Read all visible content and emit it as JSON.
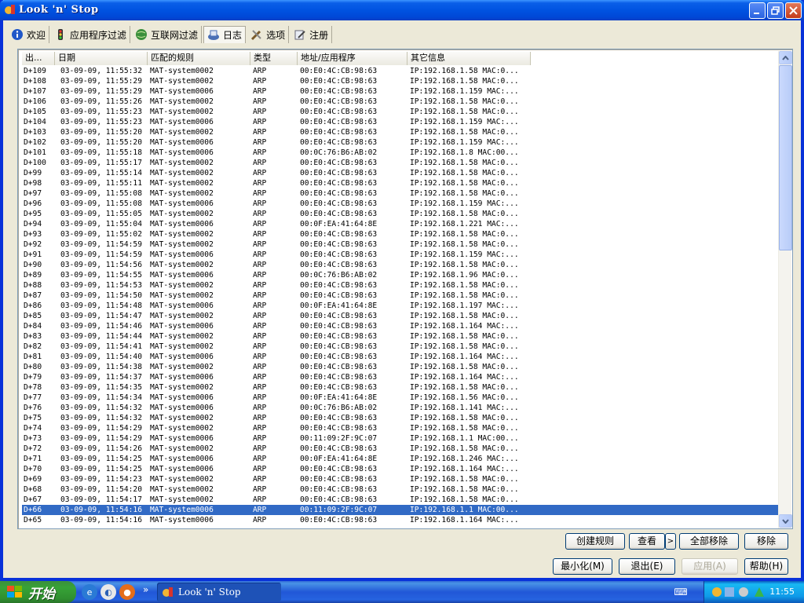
{
  "window": {
    "title": "Look 'n' Stop"
  },
  "tabs": [
    {
      "label": "欢迎",
      "icon": "info-icon"
    },
    {
      "label": "应用程序过滤",
      "icon": "traffic-light-icon"
    },
    {
      "label": "互联网过滤",
      "icon": "globe-icon"
    },
    {
      "label": "日志",
      "icon": "log-icon",
      "active": true
    },
    {
      "label": "选项",
      "icon": "tools-icon"
    },
    {
      "label": "注册",
      "icon": "register-icon"
    }
  ],
  "list": {
    "columns": [
      "出...",
      "日期",
      "匹配的规则",
      "类型",
      "地址/应用程序",
      "其它信息"
    ],
    "rows": [
      [
        "D+109",
        "03-09-09, 11:55:32",
        "MAT-system0002",
        "ARP",
        "00:E0:4C:CB:98:63",
        "IP:192.168.1.58 MAC:0..."
      ],
      [
        "D+108",
        "03-09-09, 11:55:29",
        "MAT-system0002",
        "ARP",
        "00:E0:4C:CB:98:63",
        "IP:192.168.1.58 MAC:0..."
      ],
      [
        "D+107",
        "03-09-09, 11:55:29",
        "MAT-system0006",
        "ARP",
        "00:E0:4C:CB:98:63",
        "IP:192.168.1.159 MAC:..."
      ],
      [
        "D+106",
        "03-09-09, 11:55:26",
        "MAT-system0002",
        "ARP",
        "00:E0:4C:CB:98:63",
        "IP:192.168.1.58 MAC:0..."
      ],
      [
        "D+105",
        "03-09-09, 11:55:23",
        "MAT-system0002",
        "ARP",
        "00:E0:4C:CB:98:63",
        "IP:192.168.1.58 MAC:0..."
      ],
      [
        "D+104",
        "03-09-09, 11:55:23",
        "MAT-system0006",
        "ARP",
        "00:E0:4C:CB:98:63",
        "IP:192.168.1.159 MAC:..."
      ],
      [
        "D+103",
        "03-09-09, 11:55:20",
        "MAT-system0002",
        "ARP",
        "00:E0:4C:CB:98:63",
        "IP:192.168.1.58 MAC:0..."
      ],
      [
        "D+102",
        "03-09-09, 11:55:20",
        "MAT-system0006",
        "ARP",
        "00:E0:4C:CB:98:63",
        "IP:192.168.1.159 MAC:..."
      ],
      [
        "D+101",
        "03-09-09, 11:55:18",
        "MAT-system0006",
        "ARP",
        "00:0C:76:B6:AB:02",
        "IP:192.168.1.8 MAC:00..."
      ],
      [
        "D+100",
        "03-09-09, 11:55:17",
        "MAT-system0002",
        "ARP",
        "00:E0:4C:CB:98:63",
        "IP:192.168.1.58 MAC:0..."
      ],
      [
        "D+99",
        "03-09-09, 11:55:14",
        "MAT-system0002",
        "ARP",
        "00:E0:4C:CB:98:63",
        "IP:192.168.1.58 MAC:0..."
      ],
      [
        "D+98",
        "03-09-09, 11:55:11",
        "MAT-system0002",
        "ARP",
        "00:E0:4C:CB:98:63",
        "IP:192.168.1.58 MAC:0..."
      ],
      [
        "D+97",
        "03-09-09, 11:55:08",
        "MAT-system0002",
        "ARP",
        "00:E0:4C:CB:98:63",
        "IP:192.168.1.58 MAC:0..."
      ],
      [
        "D+96",
        "03-09-09, 11:55:08",
        "MAT-system0006",
        "ARP",
        "00:E0:4C:CB:98:63",
        "IP:192.168.1.159 MAC:..."
      ],
      [
        "D+95",
        "03-09-09, 11:55:05",
        "MAT-system0002",
        "ARP",
        "00:E0:4C:CB:98:63",
        "IP:192.168.1.58 MAC:0..."
      ],
      [
        "D+94",
        "03-09-09, 11:55:04",
        "MAT-system0006",
        "ARP",
        "00:0F:EA:41:64:8E",
        "IP:192.168.1.221 MAC:..."
      ],
      [
        "D+93",
        "03-09-09, 11:55:02",
        "MAT-system0002",
        "ARP",
        "00:E0:4C:CB:98:63",
        "IP:192.168.1.58 MAC:0..."
      ],
      [
        "D+92",
        "03-09-09, 11:54:59",
        "MAT-system0002",
        "ARP",
        "00:E0:4C:CB:98:63",
        "IP:192.168.1.58 MAC:0..."
      ],
      [
        "D+91",
        "03-09-09, 11:54:59",
        "MAT-system0006",
        "ARP",
        "00:E0:4C:CB:98:63",
        "IP:192.168.1.159 MAC:..."
      ],
      [
        "D+90",
        "03-09-09, 11:54:56",
        "MAT-system0002",
        "ARP",
        "00:E0:4C:CB:98:63",
        "IP:192.168.1.58 MAC:0..."
      ],
      [
        "D+89",
        "03-09-09, 11:54:55",
        "MAT-system0006",
        "ARP",
        "00:0C:76:B6:AB:02",
        "IP:192.168.1.96 MAC:0..."
      ],
      [
        "D+88",
        "03-09-09, 11:54:53",
        "MAT-system0002",
        "ARP",
        "00:E0:4C:CB:98:63",
        "IP:192.168.1.58 MAC:0..."
      ],
      [
        "D+87",
        "03-09-09, 11:54:50",
        "MAT-system0002",
        "ARP",
        "00:E0:4C:CB:98:63",
        "IP:192.168.1.58 MAC:0..."
      ],
      [
        "D+86",
        "03-09-09, 11:54:48",
        "MAT-system0006",
        "ARP",
        "00:0F:EA:41:64:8E",
        "IP:192.168.1.197 MAC:..."
      ],
      [
        "D+85",
        "03-09-09, 11:54:47",
        "MAT-system0002",
        "ARP",
        "00:E0:4C:CB:98:63",
        "IP:192.168.1.58 MAC:0..."
      ],
      [
        "D+84",
        "03-09-09, 11:54:46",
        "MAT-system0006",
        "ARP",
        "00:E0:4C:CB:98:63",
        "IP:192.168.1.164 MAC:..."
      ],
      [
        "D+83",
        "03-09-09, 11:54:44",
        "MAT-system0002",
        "ARP",
        "00:E0:4C:CB:98:63",
        "IP:192.168.1.58 MAC:0..."
      ],
      [
        "D+82",
        "03-09-09, 11:54:41",
        "MAT-system0002",
        "ARP",
        "00:E0:4C:CB:98:63",
        "IP:192.168.1.58 MAC:0..."
      ],
      [
        "D+81",
        "03-09-09, 11:54:40",
        "MAT-system0006",
        "ARP",
        "00:E0:4C:CB:98:63",
        "IP:192.168.1.164 MAC:..."
      ],
      [
        "D+80",
        "03-09-09, 11:54:38",
        "MAT-system0002",
        "ARP",
        "00:E0:4C:CB:98:63",
        "IP:192.168.1.58 MAC:0..."
      ],
      [
        "D+79",
        "03-09-09, 11:54:37",
        "MAT-system0006",
        "ARP",
        "00:E0:4C:CB:98:63",
        "IP:192.168.1.164 MAC:..."
      ],
      [
        "D+78",
        "03-09-09, 11:54:35",
        "MAT-system0002",
        "ARP",
        "00:E0:4C:CB:98:63",
        "IP:192.168.1.58 MAC:0..."
      ],
      [
        "D+77",
        "03-09-09, 11:54:34",
        "MAT-system0006",
        "ARP",
        "00:0F:EA:41:64:8E",
        "IP:192.168.1.56 MAC:0..."
      ],
      [
        "D+76",
        "03-09-09, 11:54:32",
        "MAT-system0006",
        "ARP",
        "00:0C:76:B6:AB:02",
        "IP:192.168.1.141 MAC:..."
      ],
      [
        "D+75",
        "03-09-09, 11:54:32",
        "MAT-system0002",
        "ARP",
        "00:E0:4C:CB:98:63",
        "IP:192.168.1.58 MAC:0..."
      ],
      [
        "D+74",
        "03-09-09, 11:54:29",
        "MAT-system0002",
        "ARP",
        "00:E0:4C:CB:98:63",
        "IP:192.168.1.58 MAC:0..."
      ],
      [
        "D+73",
        "03-09-09, 11:54:29",
        "MAT-system0006",
        "ARP",
        "00:11:09:2F:9C:07",
        "IP:192.168.1.1 MAC:00..."
      ],
      [
        "D+72",
        "03-09-09, 11:54:26",
        "MAT-system0002",
        "ARP",
        "00:E0:4C:CB:98:63",
        "IP:192.168.1.58 MAC:0..."
      ],
      [
        "D+71",
        "03-09-09, 11:54:25",
        "MAT-system0006",
        "ARP",
        "00:0F:EA:41:64:8E",
        "IP:192.168.1.246 MAC:..."
      ],
      [
        "D+70",
        "03-09-09, 11:54:25",
        "MAT-system0006",
        "ARP",
        "00:E0:4C:CB:98:63",
        "IP:192.168.1.164 MAC:..."
      ],
      [
        "D+69",
        "03-09-09, 11:54:23",
        "MAT-system0002",
        "ARP",
        "00:E0:4C:CB:98:63",
        "IP:192.168.1.58 MAC:0..."
      ],
      [
        "D+68",
        "03-09-09, 11:54:20",
        "MAT-system0002",
        "ARP",
        "00:E0:4C:CB:98:63",
        "IP:192.168.1.58 MAC:0..."
      ],
      [
        "D+67",
        "03-09-09, 11:54:17",
        "MAT-system0002",
        "ARP",
        "00:E0:4C:CB:98:63",
        "IP:192.168.1.58 MAC:0..."
      ],
      [
        "D+66",
        "03-09-09, 11:54:16",
        "MAT-system0006",
        "ARP",
        "00:11:09:2F:9C:07",
        "IP:192.168.1.1 MAC:00..."
      ],
      [
        "D+65",
        "03-09-09, 11:54:16",
        "MAT-system0006",
        "ARP",
        "00:E0:4C:CB:98:63",
        "IP:192.168.1.164 MAC:..."
      ]
    ],
    "selected_row": "D+66"
  },
  "buttons": {
    "create_rule": "创建规则",
    "view": "查看",
    "view_more": ">",
    "remove_all": "全部移除",
    "remove": "移除",
    "minimize": "最小化(M)",
    "exit": "退出(E)",
    "apply": "应用(A)",
    "help": "帮助(H)"
  },
  "taskbar": {
    "start": "开始",
    "task_title": "Look 'n' Stop",
    "clock": "11:55",
    "overflow": "»"
  },
  "colors": {
    "titlebar": "#0053e1",
    "selection": "#316ac5",
    "taskbar": "#2157d7",
    "start": "#37a337"
  }
}
